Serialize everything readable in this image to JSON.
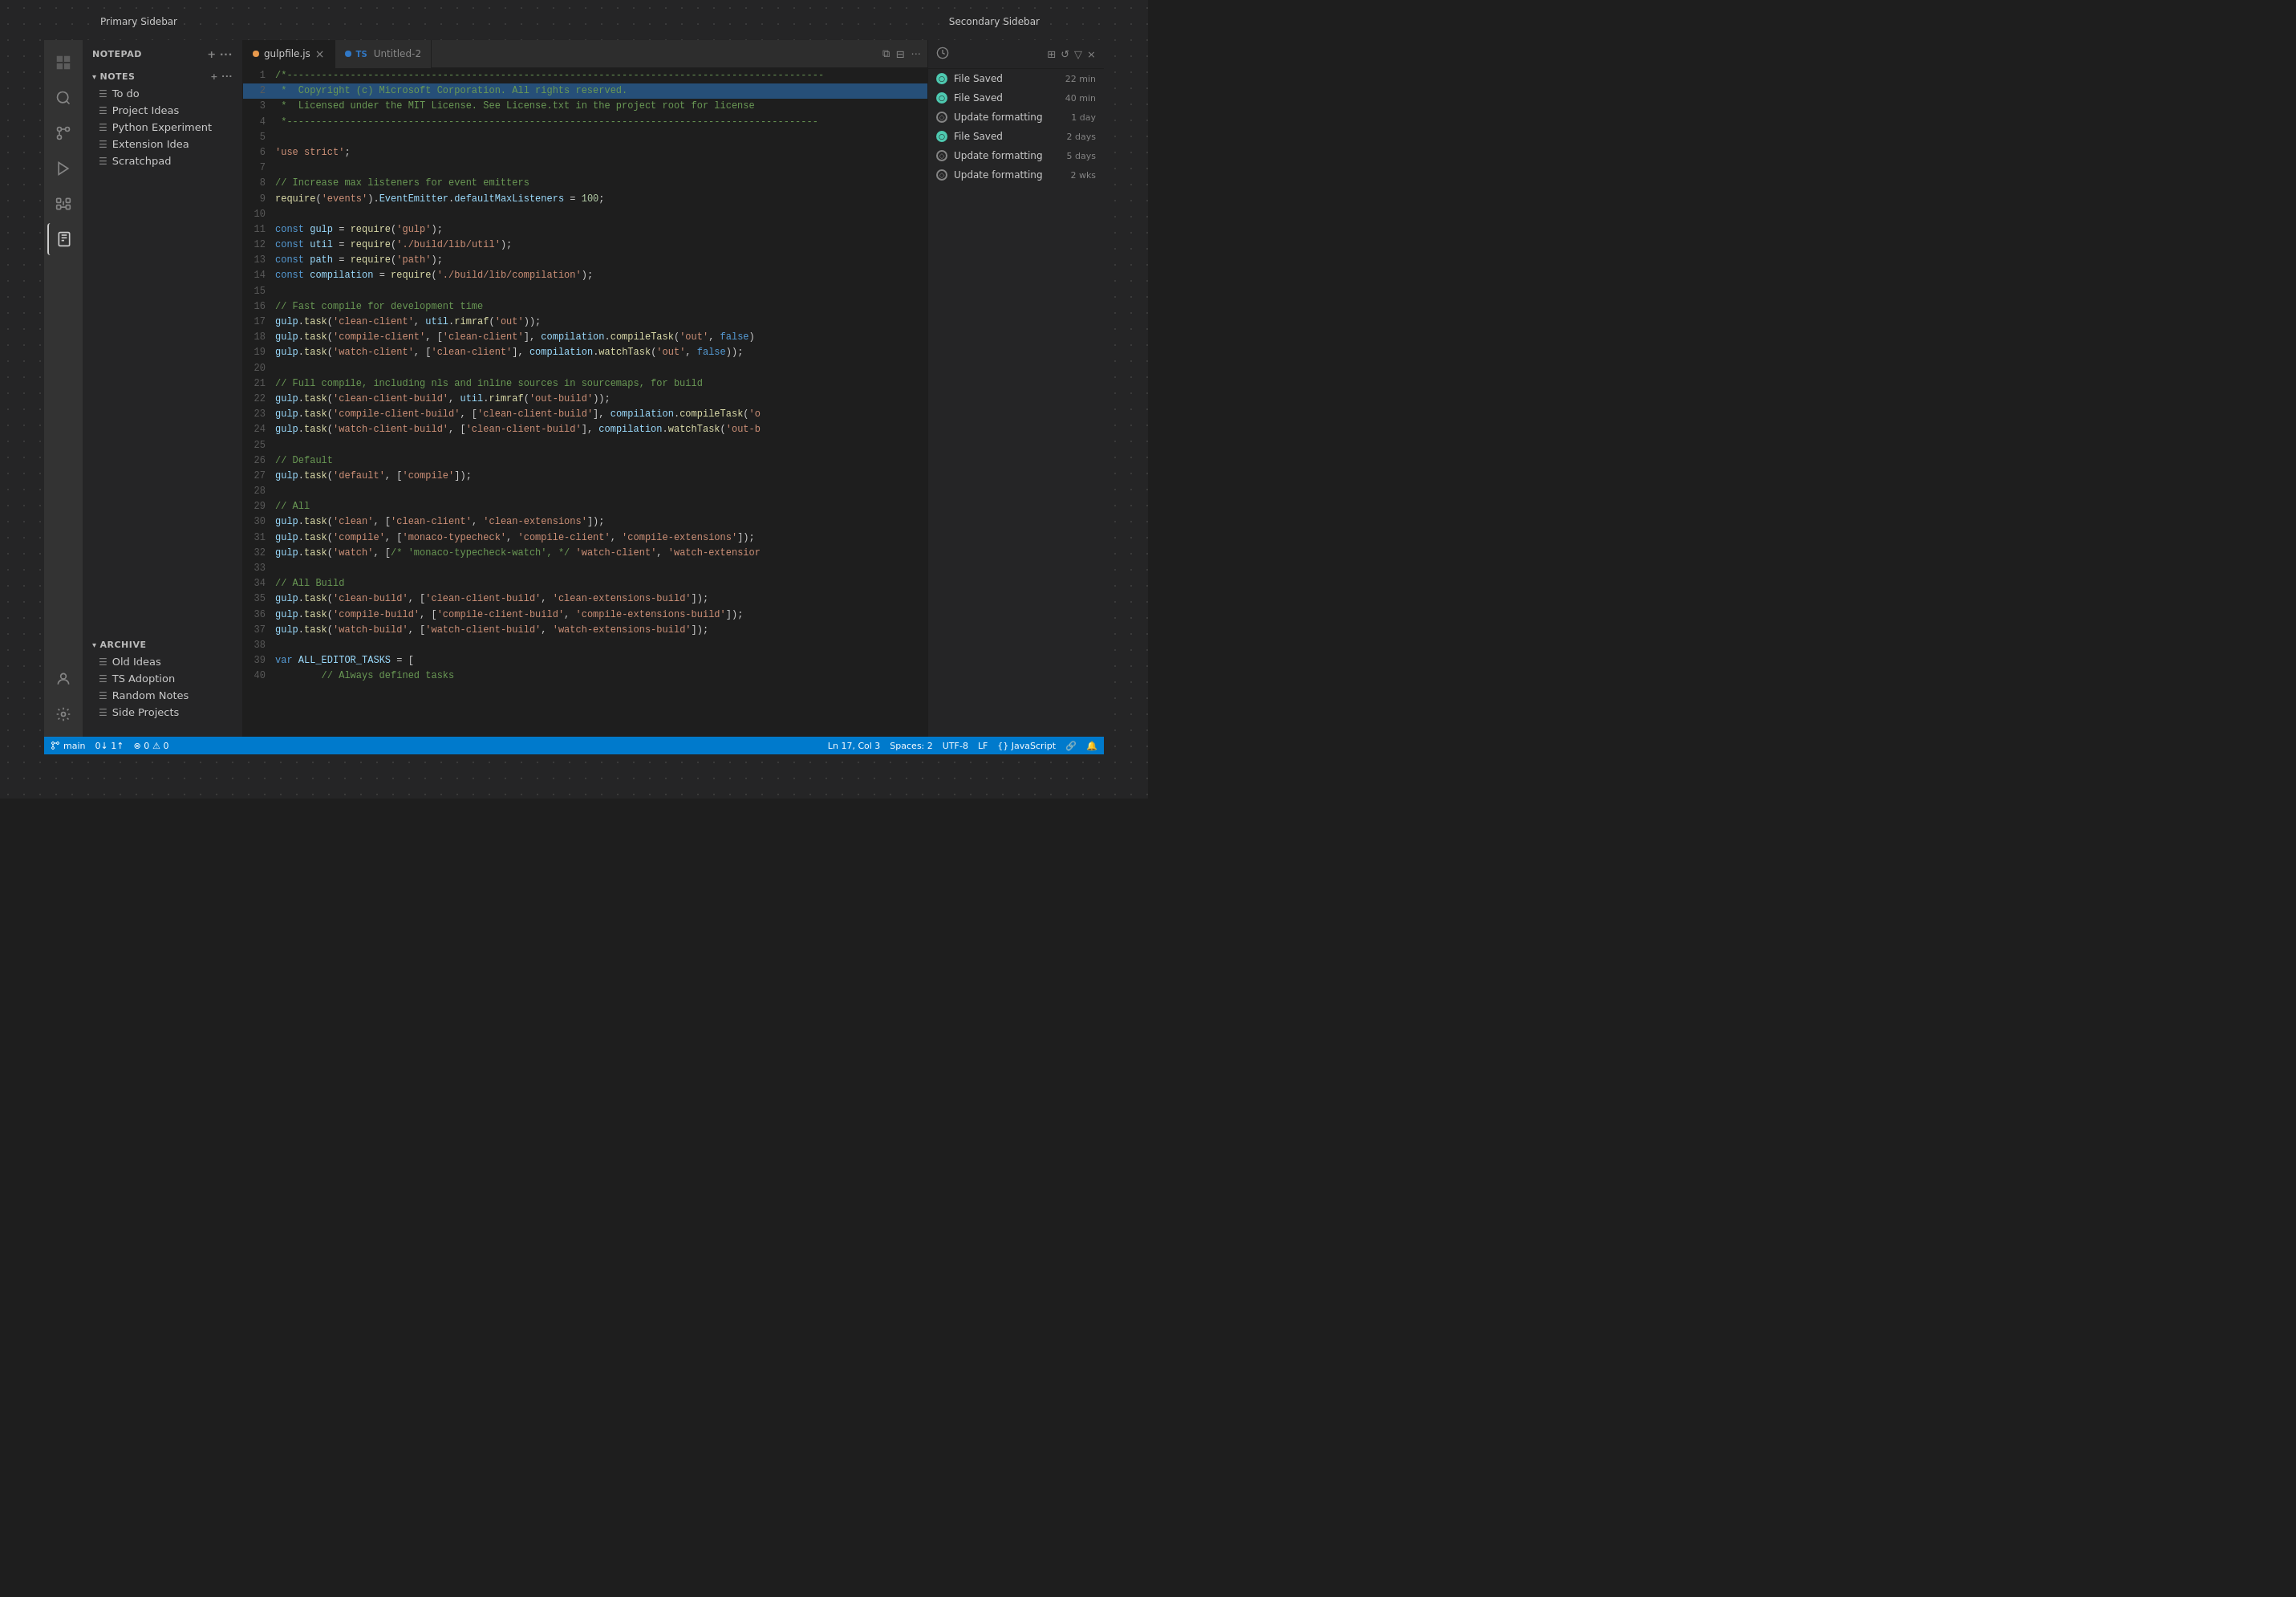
{
  "labels": {
    "primary_sidebar": "Primary Sidebar",
    "secondary_sidebar": "Secondary Sidebar"
  },
  "activity_bar": {
    "icons": [
      {
        "name": "explorer-icon",
        "symbol": "⎗",
        "active": false
      },
      {
        "name": "search-icon",
        "symbol": "⌕",
        "active": false
      },
      {
        "name": "source-control-icon",
        "symbol": "⑂",
        "active": false
      },
      {
        "name": "run-icon",
        "symbol": "▷",
        "active": false
      },
      {
        "name": "extensions-icon",
        "symbol": "⊞",
        "active": false
      },
      {
        "name": "notepad-icon",
        "symbol": "📋",
        "active": true
      }
    ],
    "bottom_icons": [
      {
        "name": "account-icon",
        "symbol": "👤"
      },
      {
        "name": "settings-icon",
        "symbol": "⚙"
      }
    ]
  },
  "notepad": {
    "header": "NOTEPAD",
    "notes_section": "NOTES",
    "archive_section": "ARCHIVE",
    "notes": [
      {
        "label": "To do",
        "type": "note"
      },
      {
        "label": "Project Ideas",
        "type": "note"
      },
      {
        "label": "Python Experiment",
        "type": "note"
      },
      {
        "label": "Extension Idea",
        "type": "note"
      },
      {
        "label": "Scratchpad",
        "type": "note"
      }
    ],
    "archive": [
      {
        "label": "Old Ideas",
        "type": "note"
      },
      {
        "label": "TS Adoption",
        "type": "note"
      },
      {
        "label": "Random Notes",
        "type": "note"
      },
      {
        "label": "Side Projects",
        "type": "note"
      }
    ]
  },
  "tabs": [
    {
      "label": "gulpfile.js",
      "active": true,
      "dot_color": "orange",
      "closeable": true
    },
    {
      "label": "Untitled-2",
      "active": false,
      "dot_color": "ts",
      "closeable": false
    }
  ],
  "editor": {
    "lines": [
      {
        "num": 1,
        "code": "/*---------------------------------------------------------------------------------------------"
      },
      {
        "num": 2,
        "code": " *  Copyright (c) Microsoft Corporation. All rights reserved.",
        "highlight": true
      },
      {
        "num": 3,
        "code": " *  Licensed under the MIT License. See License.txt in the project root for license"
      },
      {
        "num": 4,
        "code": " *--------------------------------------------------------------------------------------------"
      },
      {
        "num": 5,
        "code": ""
      },
      {
        "num": 6,
        "code": "'use strict';"
      },
      {
        "num": 7,
        "code": ""
      },
      {
        "num": 8,
        "code": "// Increase max listeners for event emitters"
      },
      {
        "num": 9,
        "code": "require('events').EventEmitter.defaultMaxListeners = 100;"
      },
      {
        "num": 10,
        "code": ""
      },
      {
        "num": 11,
        "code": "const gulp = require('gulp');"
      },
      {
        "num": 12,
        "code": "const util = require('./build/lib/util');"
      },
      {
        "num": 13,
        "code": "const path = require('path');"
      },
      {
        "num": 14,
        "code": "const compilation = require('./build/lib/compilation');"
      },
      {
        "num": 15,
        "code": ""
      },
      {
        "num": 16,
        "code": "// Fast compile for development time"
      },
      {
        "num": 17,
        "code": "gulp.task('clean-client', util.rimraf('out'));"
      },
      {
        "num": 18,
        "code": "gulp.task('compile-client', ['clean-client'], compilation.compileTask('out', false)"
      },
      {
        "num": 19,
        "code": "gulp.task('watch-client', ['clean-client'], compilation.watchTask('out', false));"
      },
      {
        "num": 20,
        "code": ""
      },
      {
        "num": 21,
        "code": "// Full compile, including nls and inline sources in sourcemaps, for build"
      },
      {
        "num": 22,
        "code": "gulp.task('clean-client-build', util.rimraf('out-build'));"
      },
      {
        "num": 23,
        "code": "gulp.task('compile-client-build', ['clean-client-build'], compilation.compileTask('o"
      },
      {
        "num": 24,
        "code": "gulp.task('watch-client-build', ['clean-client-build'], compilation.watchTask('out-b"
      },
      {
        "num": 25,
        "code": ""
      },
      {
        "num": 26,
        "code": "// Default"
      },
      {
        "num": 27,
        "code": "gulp.task('default', ['compile']);"
      },
      {
        "num": 28,
        "code": ""
      },
      {
        "num": 29,
        "code": "// All"
      },
      {
        "num": 30,
        "code": "gulp.task('clean', ['clean-client', 'clean-extensions']);"
      },
      {
        "num": 31,
        "code": "gulp.task('compile', ['monaco-typecheck', 'compile-client', 'compile-extensions']);"
      },
      {
        "num": 32,
        "code": "gulp.task('watch', [/* 'monaco-typecheck-watch', */ 'watch-client', 'watch-extensior"
      },
      {
        "num": 33,
        "code": ""
      },
      {
        "num": 34,
        "code": "// All Build"
      },
      {
        "num": 35,
        "code": "gulp.task('clean-build', ['clean-client-build', 'clean-extensions-build']);"
      },
      {
        "num": 36,
        "code": "gulp.task('compile-build', ['compile-client-build', 'compile-extensions-build']);"
      },
      {
        "num": 37,
        "code": "gulp.task('watch-build', ['watch-client-build', 'watch-extensions-build']);"
      },
      {
        "num": 38,
        "code": ""
      },
      {
        "num": 39,
        "code": "var ALL_EDITOR_TASKS = ["
      },
      {
        "num": 40,
        "code": "\t// Always defined tasks"
      }
    ]
  },
  "secondary_sidebar": {
    "title": "Secondary Sidebar",
    "timeline": [
      {
        "type": "saved",
        "label": "File Saved",
        "time": "22 min"
      },
      {
        "type": "saved",
        "label": "File Saved",
        "time": "40 min"
      },
      {
        "type": "formatting",
        "label": "Update formatting",
        "time": "1 day"
      },
      {
        "type": "saved",
        "label": "File Saved",
        "time": "2 days"
      },
      {
        "type": "formatting",
        "label": "Update formatting",
        "time": "5 days"
      },
      {
        "type": "formatting",
        "label": "Update formatting",
        "time": "2 wks"
      }
    ]
  },
  "status_bar": {
    "branch": "main",
    "sync": "0↓ 1↑",
    "errors": "⊗ 0",
    "warnings": "⚠ 0",
    "ln": "Ln 17, Col 3",
    "spaces": "Spaces: 2",
    "encoding": "UTF-8",
    "eol": "LF",
    "language": "{} JavaScript",
    "remote_icon": "🔗",
    "bell_icon": "🔔"
  }
}
